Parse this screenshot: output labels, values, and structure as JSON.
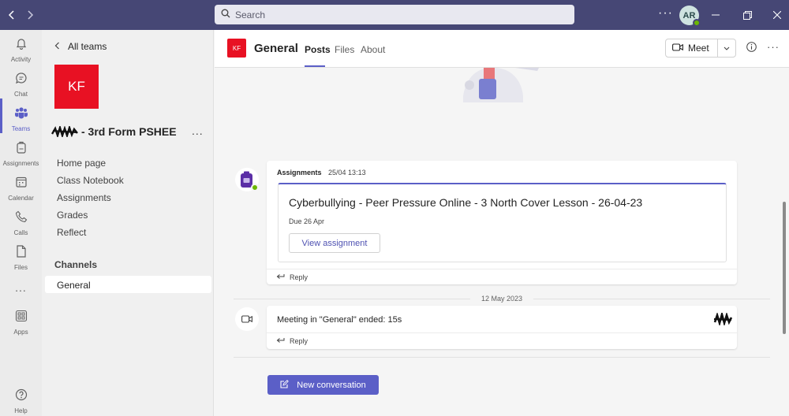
{
  "titlebar": {
    "search_placeholder": "Search",
    "user_initials": "AR"
  },
  "rail": {
    "items": [
      {
        "label": "Activity",
        "icon": "bell-icon"
      },
      {
        "label": "Chat",
        "icon": "chat-icon"
      },
      {
        "label": "Teams",
        "icon": "teams-icon"
      },
      {
        "label": "Assignments",
        "icon": "assignments-icon"
      },
      {
        "label": "Calendar",
        "icon": "calendar-icon"
      },
      {
        "label": "Calls",
        "icon": "phone-icon"
      },
      {
        "label": "Files",
        "icon": "file-icon"
      },
      {
        "label": "Apps",
        "icon": "apps-icon"
      },
      {
        "label": "Help",
        "icon": "help-icon"
      }
    ],
    "more": "..."
  },
  "teampanel": {
    "back_label": "All teams",
    "team_initials": "KF",
    "team_name": "- 3rd Form PSHEE",
    "more": "...",
    "links": [
      "Home page",
      "Class Notebook",
      "Assignments",
      "Grades",
      "Reflect"
    ],
    "channels_heading": "Channels",
    "channels": [
      "General"
    ]
  },
  "channel": {
    "initials": "KF",
    "title": "General",
    "tabs": [
      "Posts",
      "Files",
      "About"
    ],
    "meet_label": "Meet"
  },
  "feed": {
    "assignment_post": {
      "author": "Assignments",
      "timestamp": "25/04 13:13",
      "title": "Cyberbullying - Peer Pressure Online - 3 North Cover Lesson - 26-04-23",
      "due": "Due 26 Apr",
      "view_label": "View assignment",
      "reply_label": "Reply"
    },
    "date_separator": "12 May 2023",
    "meeting_post": {
      "text": "Meeting in \"General\" ended: 15s",
      "reply_label": "Reply"
    },
    "new_conversation_label": "New conversation"
  },
  "colors": {
    "titlebar": "#464775",
    "accent": "#5b5fc7",
    "team_tile": "#e81123",
    "presence": "#6bb700"
  }
}
